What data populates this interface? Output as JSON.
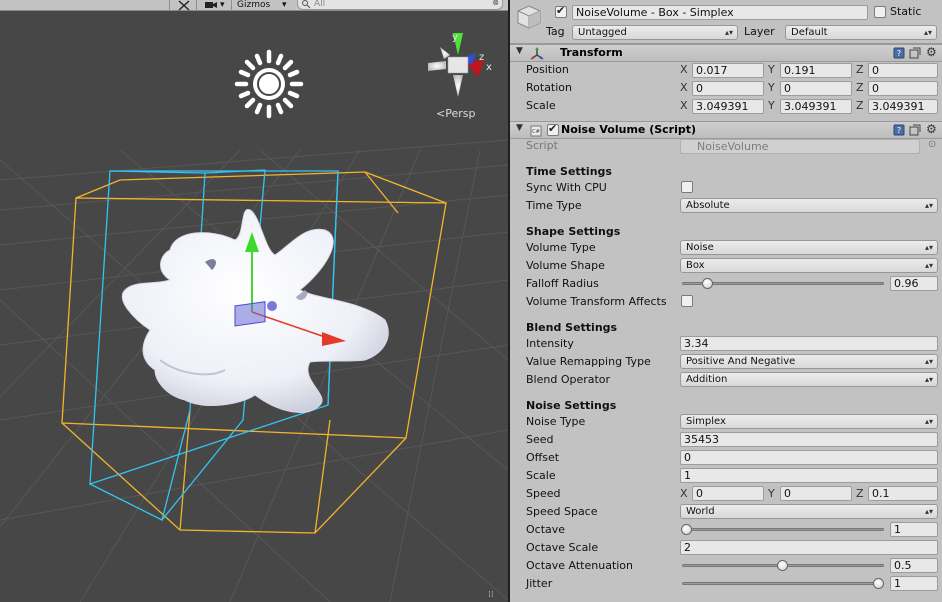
{
  "scene": {
    "toolbar": {
      "gizmos_label": "Gizmos",
      "gizmos_arrow": "▾",
      "search_placeholder": "All"
    },
    "gizmo_axes": {
      "y": "y",
      "z": "z",
      "x": "x"
    },
    "persp_label": "Persp",
    "colors": {
      "background": "#474747",
      "x_axis": "#e53a2a",
      "y_axis": "#4ee33a",
      "z_axis": "#3a63e3",
      "bounds_blue": "#3cc7f5",
      "bounds_orange": "#f5b830"
    }
  },
  "inspector": {
    "header": {
      "active_checked": true,
      "name": "NoiseVolume - Box - Simplex",
      "static_label": "Static",
      "static_checked": false,
      "tag_label": "Tag",
      "tag_value": "Untagged",
      "layer_label": "Layer",
      "layer_value": "Default"
    },
    "transform": {
      "title": "Transform",
      "icon": "transform-icon",
      "rows": [
        {
          "label": "Position",
          "x": "0.017",
          "y": "0.191",
          "z": "0"
        },
        {
          "label": "Rotation",
          "x": "0",
          "y": "0",
          "z": "0"
        },
        {
          "label": "Scale",
          "x": "3.049391",
          "y": "3.049391",
          "z": "3.049391"
        }
      ],
      "axis_labels": {
        "x": "X",
        "y": "Y",
        "z": "Z"
      }
    },
    "script_component": {
      "enabled": true,
      "title": "Noise Volume (Script)",
      "script_label": "Script",
      "script_value": "NoiseVolume"
    },
    "time_settings": {
      "title": "Time Settings",
      "sync_with_cpu_label": "Sync With CPU",
      "sync_with_cpu": false,
      "time_type_label": "Time Type",
      "time_type": "Absolute"
    },
    "shape_settings": {
      "title": "Shape Settings",
      "volume_type_label": "Volume Type",
      "volume_type": "Noise",
      "volume_shape_label": "Volume Shape",
      "volume_shape": "Box",
      "falloff_radius_label": "Falloff Radius",
      "falloff_radius": "0.96",
      "falloff_radius_fraction": 0.11,
      "volume_transform_affects_label": "Volume Transform Affects",
      "volume_transform_affects": false
    },
    "blend_settings": {
      "title": "Blend Settings",
      "intensity_label": "Intensity",
      "intensity": "3.34",
      "value_remapping_label": "Value Remapping Type",
      "value_remapping": "Positive And Negative",
      "blend_operator_label": "Blend Operator",
      "blend_operator": "Addition"
    },
    "noise_settings": {
      "title": "Noise Settings",
      "noise_type_label": "Noise Type",
      "noise_type": "Simplex",
      "seed_label": "Seed",
      "seed": "35453",
      "offset_label": "Offset",
      "offset": "0",
      "scale_label": "Scale",
      "scale": "1",
      "speed_label": "Speed",
      "speed": {
        "x": "0",
        "y": "0",
        "z": "0.1"
      },
      "speed_space_label": "Speed Space",
      "speed_space": "World",
      "octave_label": "Octave",
      "octave": "1",
      "octave_fraction": 0.0,
      "octave_scale_label": "Octave Scale",
      "octave_scale": "2",
      "octave_attenuation_label": "Octave Attenuation",
      "octave_attenuation": "0.5",
      "octave_attenuation_fraction": 0.5,
      "jitter_label": "Jitter",
      "jitter": "1",
      "jitter_fraction": 1.0
    },
    "dropdown_arrows": "▴▾"
  }
}
